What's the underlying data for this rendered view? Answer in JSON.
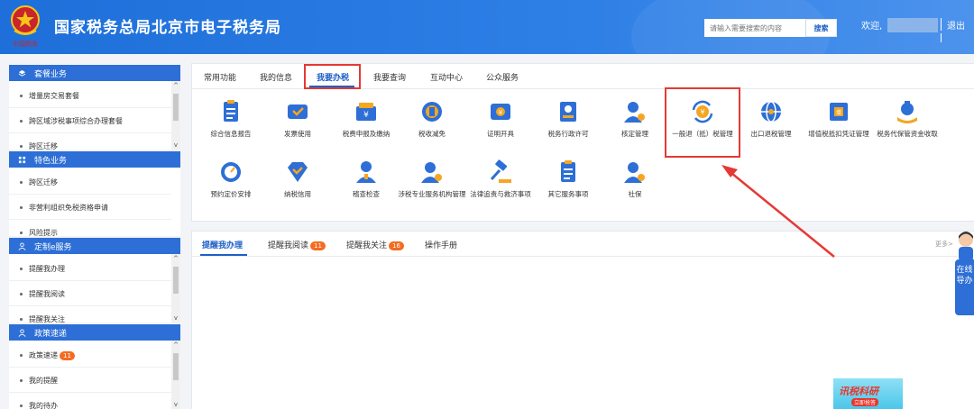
{
  "header": {
    "title": "国家税务总局北京市电子税务局",
    "search_placeholder": "请输入需要搜索的内容",
    "search_label": "搜索",
    "welcome": "欢迎,",
    "logout": "退出",
    "logo_text": "中国税务"
  },
  "sidebar": {
    "sections": [
      {
        "title": "套餐业务",
        "items": [
          "增量房交易套餐",
          "跨区域涉税事项综合办理套餐",
          "跨区迁移"
        ]
      },
      {
        "title": "特色业务",
        "items": [
          "跨区迁移",
          "非营利组织免税资格申请",
          "风险提示"
        ]
      },
      {
        "title": "定制e服务",
        "items": [
          "提醒我办理",
          "提醒我阅读",
          "提醒我关注"
        ]
      },
      {
        "title": "政策速递",
        "items": [
          "政策速递",
          "我的提醒",
          "我的待办"
        ],
        "badge": "11"
      }
    ]
  },
  "main_tabs": [
    "常用功能",
    "我的信息",
    "我要办税",
    "我要查询",
    "互动中心",
    "公众服务"
  ],
  "services_row1": [
    "综合信息报告",
    "发票使用",
    "税费申报及缴纳",
    "税收减免",
    "证明开具",
    "税务行政许可",
    "核定管理",
    "一般退（抵）税管理",
    "出口退税管理",
    "增值税抵扣凭证管理",
    "税务代保管资金收取"
  ],
  "services_row2": [
    "预约定价安排",
    "纳税信用",
    "稽查检查",
    "涉税专业服务机构管理",
    "法律追责与救济事项",
    "其它服务事项",
    "社保"
  ],
  "reminder_tabs": [
    {
      "label": "提醒我办理"
    },
    {
      "label": "提醒我阅读",
      "badge": "11"
    },
    {
      "label": "提醒我关注",
      "badge": "16"
    },
    {
      "label": "操作手册"
    }
  ],
  "more": "更多>",
  "float_assistant": "在线导办",
  "banner": {
    "title": "讯税科研",
    "button": "立即抢答"
  },
  "colors": {
    "header_blue": "#1e6fd9",
    "accent": "#1d5fc6",
    "highlight_red": "#e53935",
    "badge_orange": "#f36c21",
    "icon_blue": "#2d6fd6"
  }
}
